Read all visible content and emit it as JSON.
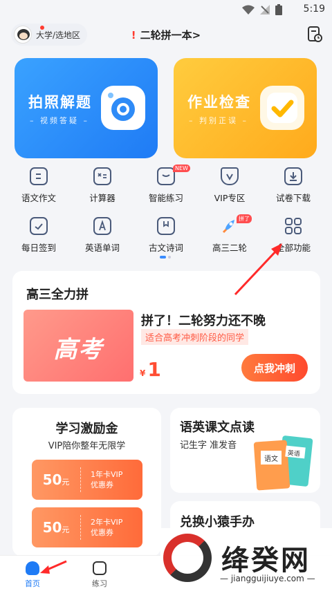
{
  "status_bar": {
    "time": "5:19",
    "icons": [
      "wifi-icon",
      "no-signal-icon",
      "battery-icon"
    ]
  },
  "header": {
    "region": "大学/选地区",
    "title": "二轮拼一本>",
    "avatar": "monkey-avatar",
    "right_icon": "schedule-book-icon"
  },
  "hero_cards": [
    {
      "title": "拍照解题",
      "subtitle": "– 视频答疑 –",
      "icon": "camera-icon"
    },
    {
      "title": "作业检查",
      "subtitle": "– 判别正误 –",
      "icon": "check-icon"
    }
  ],
  "grid": [
    {
      "label": "语文作文",
      "icon": "essay-icon"
    },
    {
      "label": "计算器",
      "icon": "calculator-icon"
    },
    {
      "label": "智能练习",
      "icon": "practice-icon",
      "badge": "NEW"
    },
    {
      "label": "VIP专区",
      "icon": "vip-icon"
    },
    {
      "label": "试卷下载",
      "icon": "download-icon"
    },
    {
      "label": "每日签到",
      "icon": "calendar-check-icon"
    },
    {
      "label": "英语单词",
      "icon": "letter-a-icon"
    },
    {
      "label": "古文诗词",
      "icon": "bookmark-icon"
    },
    {
      "label": "高三二轮",
      "icon": "rocket-icon",
      "badge": "拼了"
    },
    {
      "label": "全部功能",
      "icon": "apps-grid-icon"
    }
  ],
  "promo": {
    "heading": "高三全力拼",
    "image_text": "高考",
    "headline": "拼了！二轮努力还不晚",
    "tag": "适合高考冲刺阶段的同学",
    "currency": "¥",
    "price": "1",
    "button": "点我冲刺"
  },
  "incentive": {
    "title": "学习激励金",
    "subtitle": "VIP陪你整年无限学",
    "coupons": [
      {
        "value": "50",
        "unit": "元",
        "line1": "1年卡VIP",
        "line2": "优惠券"
      },
      {
        "value": "50",
        "unit": "元",
        "line1": "2年卡VIP",
        "line2": "优惠券"
      }
    ]
  },
  "reading": {
    "title": "语英课文点读",
    "subtitle": "记生字 准发音",
    "book1": "语文",
    "book2": "英语"
  },
  "exchange": {
    "title": "兑换小猿手办"
  },
  "tabs": [
    {
      "label": "首页",
      "active": true
    },
    {
      "label": "练习",
      "active": false
    }
  ],
  "watermark": {
    "name": "绛癸网",
    "url": "— jiangguijiuye.com —"
  },
  "colors": {
    "accent_red": "#ff4a2e",
    "blue": "#1f7bf5",
    "orange": "#ffaa1c",
    "annotation": "#ff2a2a"
  }
}
